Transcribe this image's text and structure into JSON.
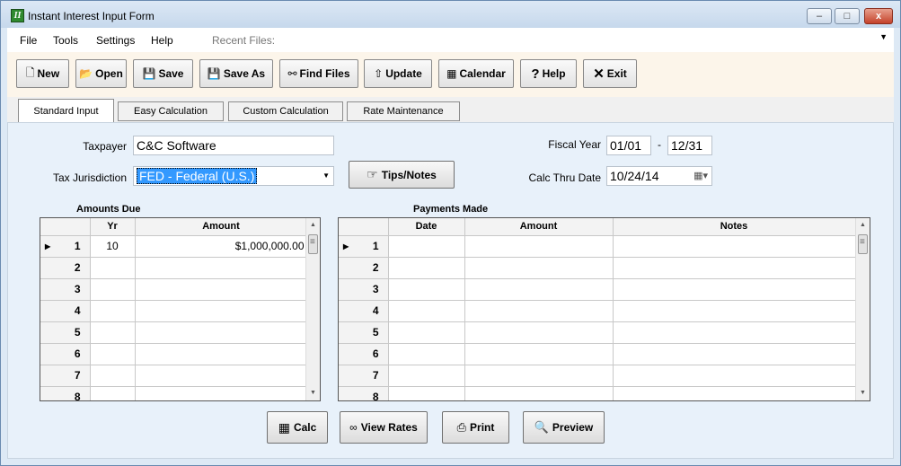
{
  "window": {
    "title": "Instant Interest Input Form",
    "icon_letter": "II"
  },
  "titlebar_buttons": {
    "minimize": "–",
    "maximize": "□",
    "close": "x"
  },
  "menu": {
    "items": [
      "File",
      "Tools",
      "Settings",
      "Help"
    ],
    "recent_label": "Recent Files:",
    "recent_value": ""
  },
  "toolbar": {
    "new": "New",
    "open": "Open",
    "save": "Save",
    "save_as": "Save As",
    "find_files": "Find Files",
    "update": "Update",
    "calendar": "Calendar",
    "help": "Help",
    "exit": "Exit"
  },
  "tabs": [
    "Standard Input",
    "Easy Calculation",
    "Custom Calculation",
    "Rate Maintenance"
  ],
  "active_tab": "Standard Input",
  "form": {
    "taxpayer_label": "Taxpayer",
    "taxpayer_value": "C&C Software",
    "jurisdiction_label": "Tax Jurisdiction",
    "jurisdiction_value": "FED - Federal (U.S.)",
    "tips_button": "Tips/Notes",
    "fiscal_year_label": "Fiscal Year",
    "fiscal_start": "01/01",
    "fiscal_sep": "-",
    "fiscal_end": "12/31",
    "calc_thru_label": "Calc Thru Date",
    "calc_thru_value": "10/24/14"
  },
  "amounts_due": {
    "label": "Amounts Due",
    "headers": [
      "",
      "Yr",
      "Amount"
    ],
    "rows": [
      [
        "1",
        "10",
        "$1,000,000.00"
      ],
      [
        "2",
        "",
        ""
      ],
      [
        "3",
        "",
        ""
      ],
      [
        "4",
        "",
        ""
      ],
      [
        "5",
        "",
        ""
      ],
      [
        "6",
        "",
        ""
      ],
      [
        "7",
        "",
        ""
      ],
      [
        "8",
        "",
        ""
      ]
    ]
  },
  "payments_made": {
    "label": "Payments Made",
    "headers": [
      "",
      "Date",
      "Amount",
      "Notes"
    ],
    "rows": [
      [
        "1",
        "",
        "",
        ""
      ],
      [
        "2",
        "",
        "",
        ""
      ],
      [
        "3",
        "",
        "",
        ""
      ],
      [
        "4",
        "",
        "",
        ""
      ],
      [
        "5",
        "",
        "",
        ""
      ],
      [
        "6",
        "",
        "",
        ""
      ],
      [
        "7",
        "",
        "",
        ""
      ],
      [
        "8",
        "",
        "",
        ""
      ]
    ]
  },
  "bottom_buttons": {
    "calc": "Calc",
    "view_rates": "View Rates",
    "print": "Print",
    "preview": "Preview"
  },
  "colors": {
    "panel_bg": "#e8f1fa",
    "toolbar_bg": "#fcf5ea",
    "selection": "#3399ff"
  }
}
